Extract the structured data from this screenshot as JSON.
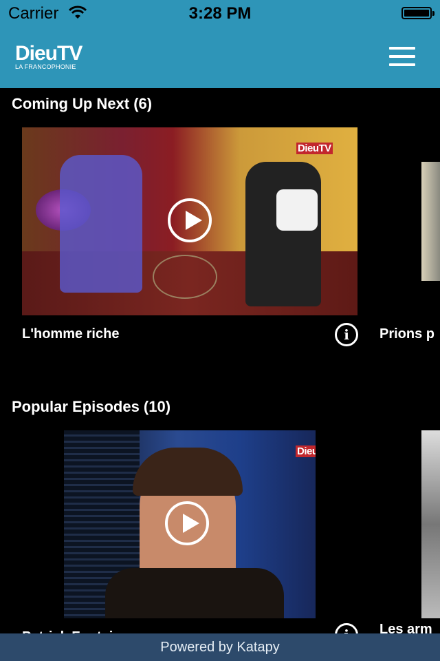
{
  "status_bar": {
    "carrier": "Carrier",
    "time": "3:28 PM"
  },
  "header": {
    "logo_text": "DieuTV",
    "logo_subtitle": "LA FRANCOPHONIE"
  },
  "sections": [
    {
      "title": "Coming Up Next (6)",
      "items": [
        {
          "title": "L'homme riche",
          "watermark": "DieuTV"
        },
        {
          "title": "Prions p"
        }
      ]
    },
    {
      "title": "Popular Episodes (10)",
      "items": [
        {
          "title": "Patrick Fontain",
          "watermark": "DieuTV"
        },
        {
          "title": "Les arm"
        }
      ]
    }
  ],
  "footer": {
    "text": "Powered by Katapy"
  },
  "colors": {
    "nav": "#2e95b8",
    "footer": "#2d4a6b",
    "background": "#000000"
  }
}
